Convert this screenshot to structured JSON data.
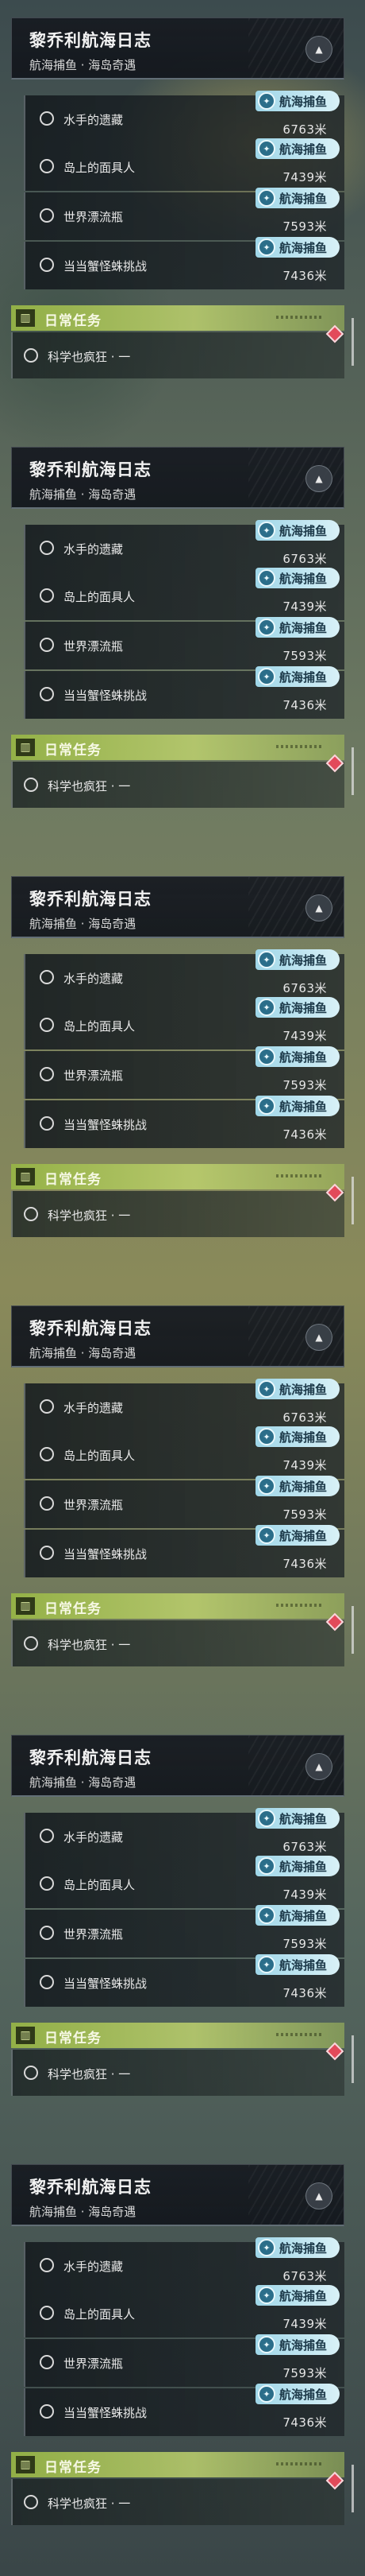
{
  "panels": [
    {
      "title": "黎乔利航海日志",
      "subtitle": "航海捕鱼 · 海岛奇遇",
      "quests": [
        {
          "name": "水手的遗藏",
          "tag": "航海捕鱼",
          "distance": "6763米"
        },
        {
          "name": "岛上的面具人",
          "tag": "航海捕鱼",
          "distance": "7439米"
        },
        {
          "name": "世界漂流瓶",
          "tag": "航海捕鱼",
          "distance": "7593米"
        },
        {
          "name": "当当蟹怪蛛挑战",
          "tag": "航海捕鱼",
          "distance": "7436米"
        }
      ],
      "daily_label": "日常任务",
      "daily_items": [
        {
          "name": "科学也疯狂 · 一"
        }
      ]
    },
    {
      "title": "黎乔利航海日志",
      "subtitle": "航海捕鱼 · 海岛奇遇",
      "quests": [
        {
          "name": "水手的遗藏",
          "tag": "航海捕鱼",
          "distance": "6763米"
        },
        {
          "name": "岛上的面具人",
          "tag": "航海捕鱼",
          "distance": "7439米"
        },
        {
          "name": "世界漂流瓶",
          "tag": "航海捕鱼",
          "distance": "7593米"
        },
        {
          "name": "当当蟹怪蛛挑战",
          "tag": "航海捕鱼",
          "distance": "7436米"
        }
      ],
      "daily_label": "日常任务",
      "daily_items": [
        {
          "name": "科学也疯狂 · 一"
        }
      ]
    },
    {
      "title": "黎乔利航海日志",
      "subtitle": "航海捕鱼 · 海岛奇遇",
      "quests": [
        {
          "name": "水手的遗藏",
          "tag": "航海捕鱼",
          "distance": "6763米"
        },
        {
          "name": "岛上的面具人",
          "tag": "航海捕鱼",
          "distance": "7439米"
        },
        {
          "name": "世界漂流瓶",
          "tag": "航海捕鱼",
          "distance": "7593米"
        },
        {
          "name": "当当蟹怪蛛挑战",
          "tag": "航海捕鱼",
          "distance": "7436米"
        }
      ],
      "daily_label": "日常任务",
      "daily_items": [
        {
          "name": "科学也疯狂 · 一"
        }
      ]
    },
    {
      "title": "黎乔利航海日志",
      "subtitle": "航海捕鱼 · 海岛奇遇",
      "quests": [
        {
          "name": "水手的遗藏",
          "tag": "航海捕鱼",
          "distance": "6763米"
        },
        {
          "name": "岛上的面具人",
          "tag": "航海捕鱼",
          "distance": "7439米"
        },
        {
          "name": "世界漂流瓶",
          "tag": "航海捕鱼",
          "distance": "7593米"
        },
        {
          "name": "当当蟹怪蛛挑战",
          "tag": "航海捕鱼",
          "distance": "7436米"
        }
      ],
      "daily_label": "日常任务",
      "daily_items": [
        {
          "name": "科学也疯狂 · 一"
        }
      ]
    },
    {
      "title": "黎乔利航海日志",
      "subtitle": "航海捕鱼 · 海岛奇遇",
      "quests": [
        {
          "name": "水手的遗藏",
          "tag": "航海捕鱼",
          "distance": "6763米"
        },
        {
          "name": "岛上的面具人",
          "tag": "航海捕鱼",
          "distance": "7439米"
        },
        {
          "name": "世界漂流瓶",
          "tag": "航海捕鱼",
          "distance": "7593米"
        },
        {
          "name": "当当蟹怪蛛挑战",
          "tag": "航海捕鱼",
          "distance": "7436米"
        }
      ],
      "daily_label": "日常任务",
      "daily_items": [
        {
          "name": "科学也疯狂 · 一"
        }
      ]
    },
    {
      "title": "黎乔利航海日志",
      "subtitle": "航海捕鱼 · 海岛奇遇",
      "quests": [
        {
          "name": "水手的遗藏",
          "tag": "航海捕鱼",
          "distance": "6763米"
        },
        {
          "name": "岛上的面具人",
          "tag": "航海捕鱼",
          "distance": "7439米"
        },
        {
          "name": "世界漂流瓶",
          "tag": "航海捕鱼",
          "distance": "7593米"
        },
        {
          "name": "当当蟹怪蛛挑战",
          "tag": "航海捕鱼",
          "distance": "7436米"
        }
      ],
      "daily_label": "日常任务",
      "daily_items": [
        {
          "name": "科学也疯狂 · 一"
        }
      ]
    }
  ],
  "icons": {
    "collapse": "chevron-up-icon",
    "quest_status": "circle-outline-icon",
    "tag": "fishing-tag-icon",
    "daily": "book-icon",
    "tracking": "red-diamond-marker-icon"
  },
  "colors": {
    "accent_green": "#a8c85a",
    "tag_blue": "#9fd6e8",
    "marker_red": "#e24a5a"
  }
}
